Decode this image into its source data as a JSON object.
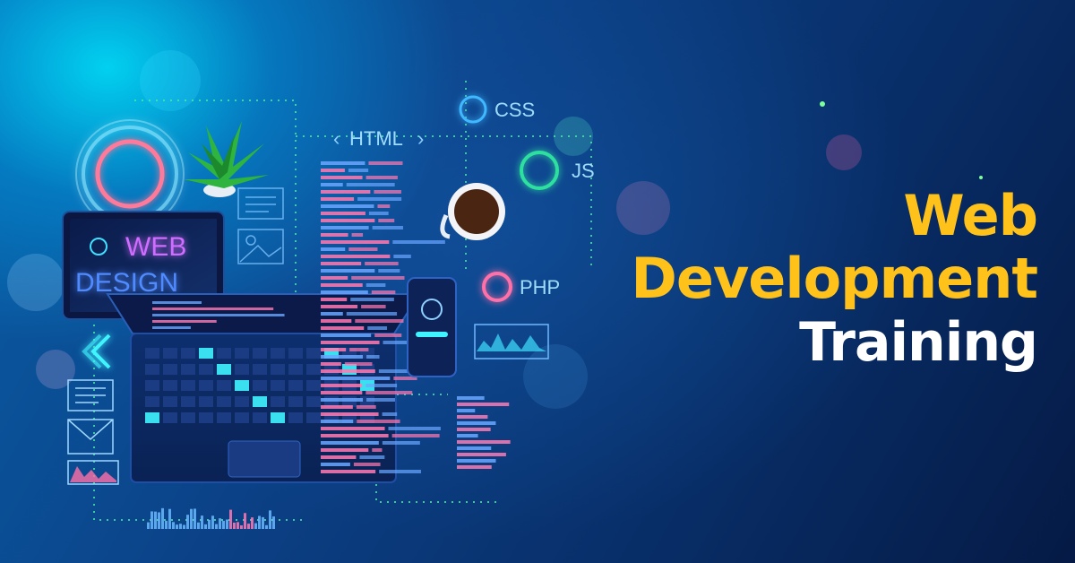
{
  "headline": {
    "line1": "Web",
    "line2": "Development",
    "line3": "Training"
  },
  "illustration": {
    "tech_labels": {
      "html": "HTML",
      "css": "CSS",
      "js": "JS",
      "php": "PHP"
    },
    "tablet_text": {
      "line1": "WEB",
      "line2": "DESIGN"
    },
    "icons": [
      "plant-icon",
      "coffee-cup-icon",
      "chevron-left-icon",
      "user-group-icon",
      "waveform-icon",
      "email-icon",
      "chart-icon"
    ],
    "colors": {
      "headline_yellow": "#ffc21a",
      "headline_white": "#ffffff",
      "neon_pink": "#ff6fa8",
      "neon_cyan": "#3ff4ff",
      "code_pink": "#ff7ab3",
      "code_blue": "#6aa7ff"
    }
  }
}
